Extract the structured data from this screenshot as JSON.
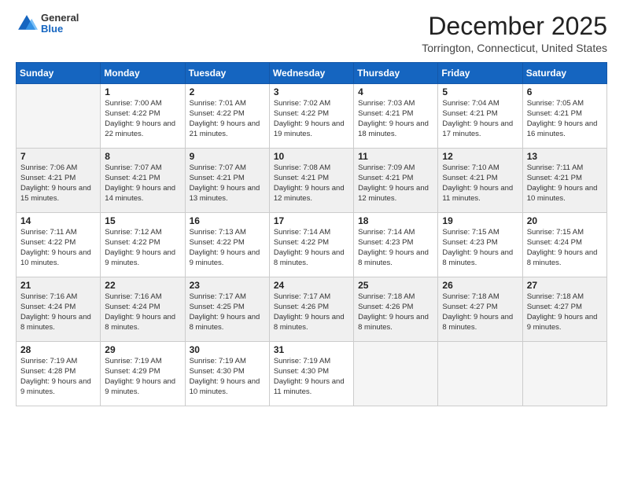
{
  "logo": {
    "general": "General",
    "blue": "Blue"
  },
  "title": "December 2025",
  "location": "Torrington, Connecticut, United States",
  "days_header": [
    "Sunday",
    "Monday",
    "Tuesday",
    "Wednesday",
    "Thursday",
    "Friday",
    "Saturday"
  ],
  "weeks": [
    [
      {
        "day": "",
        "sunrise": "",
        "sunset": "",
        "daylight": ""
      },
      {
        "day": "1",
        "sunrise": "7:00 AM",
        "sunset": "4:22 PM",
        "daylight": "9 hours and 22 minutes."
      },
      {
        "day": "2",
        "sunrise": "7:01 AM",
        "sunset": "4:22 PM",
        "daylight": "9 hours and 21 minutes."
      },
      {
        "day": "3",
        "sunrise": "7:02 AM",
        "sunset": "4:22 PM",
        "daylight": "9 hours and 19 minutes."
      },
      {
        "day": "4",
        "sunrise": "7:03 AM",
        "sunset": "4:21 PM",
        "daylight": "9 hours and 18 minutes."
      },
      {
        "day": "5",
        "sunrise": "7:04 AM",
        "sunset": "4:21 PM",
        "daylight": "9 hours and 17 minutes."
      },
      {
        "day": "6",
        "sunrise": "7:05 AM",
        "sunset": "4:21 PM",
        "daylight": "9 hours and 16 minutes."
      }
    ],
    [
      {
        "day": "7",
        "sunrise": "7:06 AM",
        "sunset": "4:21 PM",
        "daylight": "9 hours and 15 minutes."
      },
      {
        "day": "8",
        "sunrise": "7:07 AM",
        "sunset": "4:21 PM",
        "daylight": "9 hours and 14 minutes."
      },
      {
        "day": "9",
        "sunrise": "7:07 AM",
        "sunset": "4:21 PM",
        "daylight": "9 hours and 13 minutes."
      },
      {
        "day": "10",
        "sunrise": "7:08 AM",
        "sunset": "4:21 PM",
        "daylight": "9 hours and 12 minutes."
      },
      {
        "day": "11",
        "sunrise": "7:09 AM",
        "sunset": "4:21 PM",
        "daylight": "9 hours and 12 minutes."
      },
      {
        "day": "12",
        "sunrise": "7:10 AM",
        "sunset": "4:21 PM",
        "daylight": "9 hours and 11 minutes."
      },
      {
        "day": "13",
        "sunrise": "7:11 AM",
        "sunset": "4:21 PM",
        "daylight": "9 hours and 10 minutes."
      }
    ],
    [
      {
        "day": "14",
        "sunrise": "7:11 AM",
        "sunset": "4:22 PM",
        "daylight": "9 hours and 10 minutes."
      },
      {
        "day": "15",
        "sunrise": "7:12 AM",
        "sunset": "4:22 PM",
        "daylight": "9 hours and 9 minutes."
      },
      {
        "day": "16",
        "sunrise": "7:13 AM",
        "sunset": "4:22 PM",
        "daylight": "9 hours and 9 minutes."
      },
      {
        "day": "17",
        "sunrise": "7:14 AM",
        "sunset": "4:22 PM",
        "daylight": "9 hours and 8 minutes."
      },
      {
        "day": "18",
        "sunrise": "7:14 AM",
        "sunset": "4:23 PM",
        "daylight": "9 hours and 8 minutes."
      },
      {
        "day": "19",
        "sunrise": "7:15 AM",
        "sunset": "4:23 PM",
        "daylight": "9 hours and 8 minutes."
      },
      {
        "day": "20",
        "sunrise": "7:15 AM",
        "sunset": "4:24 PM",
        "daylight": "9 hours and 8 minutes."
      }
    ],
    [
      {
        "day": "21",
        "sunrise": "7:16 AM",
        "sunset": "4:24 PM",
        "daylight": "9 hours and 8 minutes."
      },
      {
        "day": "22",
        "sunrise": "7:16 AM",
        "sunset": "4:24 PM",
        "daylight": "9 hours and 8 minutes."
      },
      {
        "day": "23",
        "sunrise": "7:17 AM",
        "sunset": "4:25 PM",
        "daylight": "9 hours and 8 minutes."
      },
      {
        "day": "24",
        "sunrise": "7:17 AM",
        "sunset": "4:26 PM",
        "daylight": "9 hours and 8 minutes."
      },
      {
        "day": "25",
        "sunrise": "7:18 AM",
        "sunset": "4:26 PM",
        "daylight": "9 hours and 8 minutes."
      },
      {
        "day": "26",
        "sunrise": "7:18 AM",
        "sunset": "4:27 PM",
        "daylight": "9 hours and 8 minutes."
      },
      {
        "day": "27",
        "sunrise": "7:18 AM",
        "sunset": "4:27 PM",
        "daylight": "9 hours and 9 minutes."
      }
    ],
    [
      {
        "day": "28",
        "sunrise": "7:19 AM",
        "sunset": "4:28 PM",
        "daylight": "9 hours and 9 minutes."
      },
      {
        "day": "29",
        "sunrise": "7:19 AM",
        "sunset": "4:29 PM",
        "daylight": "9 hours and 9 minutes."
      },
      {
        "day": "30",
        "sunrise": "7:19 AM",
        "sunset": "4:30 PM",
        "daylight": "9 hours and 10 minutes."
      },
      {
        "day": "31",
        "sunrise": "7:19 AM",
        "sunset": "4:30 PM",
        "daylight": "9 hours and 11 minutes."
      },
      {
        "day": "",
        "sunrise": "",
        "sunset": "",
        "daylight": ""
      },
      {
        "day": "",
        "sunrise": "",
        "sunset": "",
        "daylight": ""
      },
      {
        "day": "",
        "sunrise": "",
        "sunset": "",
        "daylight": ""
      }
    ]
  ],
  "labels": {
    "sunrise_prefix": "Sunrise: ",
    "sunset_prefix": "Sunset: ",
    "daylight_prefix": "Daylight: "
  }
}
